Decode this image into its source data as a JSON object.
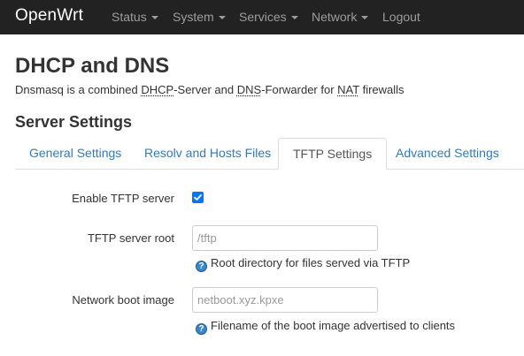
{
  "navbar": {
    "brand": "OpenWrt",
    "items": [
      {
        "label": "Status",
        "has_dropdown": true
      },
      {
        "label": "System",
        "has_dropdown": true
      },
      {
        "label": "Services",
        "has_dropdown": true
      },
      {
        "label": "Network",
        "has_dropdown": true
      },
      {
        "label": "Logout",
        "has_dropdown": false
      }
    ]
  },
  "page": {
    "title": "DHCP and DNS",
    "description": {
      "prefix": "Dnsmasq is a combined ",
      "abbr_dhcp": "DHCP",
      "mid1": "-Server and ",
      "abbr_dns": "DNS",
      "mid2": "-Forwarder for ",
      "abbr_nat": "NAT",
      "suffix": " firewalls"
    }
  },
  "section": {
    "title": "Server Settings",
    "tabs": [
      {
        "label": "General Settings",
        "active": false
      },
      {
        "label": "Resolv and Hosts Files",
        "active": false
      },
      {
        "label": "TFTP Settings",
        "active": true
      },
      {
        "label": "Advanced Settings",
        "active": false
      }
    ]
  },
  "form": {
    "enable_tftp": {
      "label": "Enable TFTP server",
      "checked": true
    },
    "tftp_root": {
      "label": "TFTP server root",
      "placeholder": "/tftp",
      "value": "",
      "help": "Root directory for files served via TFTP"
    },
    "boot_image": {
      "label": "Network boot image",
      "placeholder": "netboot.xyz.kpxe",
      "value": "",
      "help": "Filename of the boot image advertised to clients"
    }
  },
  "icons": {
    "help": "help-circle-icon",
    "caret": "caret-down-icon",
    "checkmark": "checkmark-icon"
  },
  "colors": {
    "navbar_bg": "#222222",
    "link": "#337ab7",
    "checkbox": "#0075ff",
    "help_icon": "#3a87c8"
  }
}
